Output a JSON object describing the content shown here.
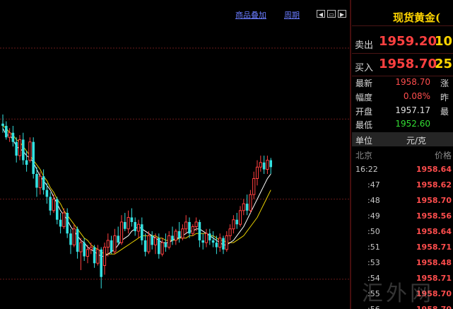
{
  "toolbar": {
    "overlay_label": "商品叠加",
    "period_label": "周期",
    "prev_label": "◀",
    "mid_label": "▭",
    "next_label": "▶"
  },
  "instrument": {
    "title": "现货黄金("
  },
  "quotes": {
    "sell": {
      "label": "卖出",
      "price": "1959.20",
      "volume": "10"
    },
    "buy": {
      "label": "买入",
      "price": "1958.70",
      "volume": "25"
    }
  },
  "stats": [
    {
      "label": "最新",
      "value": "1958.70",
      "color": "#ff4d4d",
      "label2": "涨"
    },
    {
      "label": "幅度",
      "value": "0.08%",
      "color": "#ff4d4d",
      "label2": "昨"
    },
    {
      "label": "开盘",
      "value": "1957.17",
      "color": "#e0e0e0",
      "label2": "最"
    },
    {
      "label": "最低",
      "value": "1952.60",
      "color": "#33dd33",
      "label2": ""
    }
  ],
  "unit": {
    "label": "单位",
    "value": "元/克"
  },
  "ticks_header": {
    "location": "北京",
    "price": "价格"
  },
  "ticks": [
    {
      "time": "16:22",
      "price": "1958.64"
    },
    {
      "time": ":47",
      "price": "1958.62"
    },
    {
      "time": ":48",
      "price": "1958.70"
    },
    {
      "time": ":49",
      "price": "1958.56"
    },
    {
      "time": ":50",
      "price": "1958.64"
    },
    {
      "time": ":51",
      "price": "1958.71"
    },
    {
      "time": ":53",
      "price": "1958.48"
    },
    {
      "time": ":54",
      "price": "1958.71"
    },
    {
      "time": ":55",
      "price": "1958.70"
    },
    {
      "time": ":56",
      "price": "1958.70"
    }
  ],
  "watermark": "汇外网",
  "colors": {
    "up": "#ff4040",
    "down": "#33e0e0",
    "ma1": "#ffffff",
    "ma2": "#e8d000",
    "grid": "#6a1a1a"
  },
  "chart_data": {
    "type": "candlestick",
    "ylim": [
      1949.5,
      1963.0
    ],
    "gridlines": [
      1960.9,
      1957.8,
      1954.3,
      1950.8
    ],
    "candles": [
      [
        1957.6,
        1958.0,
        1957.2,
        1957.5
      ],
      [
        1957.5,
        1957.7,
        1956.9,
        1957.0
      ],
      [
        1957.0,
        1957.4,
        1956.8,
        1957.2
      ],
      [
        1957.2,
        1957.5,
        1956.6,
        1956.8
      ],
      [
        1956.8,
        1957.0,
        1955.9,
        1956.2
      ],
      [
        1956.2,
        1957.1,
        1956.0,
        1956.9
      ],
      [
        1956.9,
        1957.2,
        1955.8,
        1956.0
      ],
      [
        1956.0,
        1956.4,
        1955.5,
        1955.8
      ],
      [
        1956.0,
        1957.0,
        1955.9,
        1956.8
      ],
      [
        1956.8,
        1957.0,
        1955.2,
        1955.4
      ],
      [
        1955.4,
        1955.7,
        1954.4,
        1954.8
      ],
      [
        1954.8,
        1955.5,
        1954.5,
        1955.3
      ],
      [
        1955.3,
        1955.6,
        1954.5,
        1954.7
      ],
      [
        1954.7,
        1955.0,
        1954.1,
        1954.4
      ],
      [
        1954.4,
        1954.6,
        1953.6,
        1953.8
      ],
      [
        1953.8,
        1954.5,
        1953.7,
        1954.3
      ],
      [
        1954.3,
        1954.4,
        1953.2,
        1953.4
      ],
      [
        1953.4,
        1953.7,
        1952.8,
        1953.1
      ],
      [
        1953.1,
        1953.9,
        1953.0,
        1953.7
      ],
      [
        1953.7,
        1953.9,
        1952.6,
        1952.8
      ],
      [
        1952.8,
        1953.0,
        1951.9,
        1952.3
      ],
      [
        1952.3,
        1953.2,
        1952.2,
        1953.0
      ],
      [
        1953.0,
        1953.1,
        1951.7,
        1952.0
      ],
      [
        1952.0,
        1952.6,
        1951.2,
        1952.4
      ],
      [
        1952.4,
        1952.6,
        1951.6,
        1951.8
      ],
      [
        1951.8,
        1952.3,
        1951.5,
        1952.1
      ],
      [
        1952.1,
        1952.4,
        1951.9,
        1952.2
      ],
      [
        1952.2,
        1952.3,
        1951.3,
        1951.5
      ],
      [
        1951.5,
        1952.3,
        1951.4,
        1952.1
      ],
      [
        1952.1,
        1952.2,
        1950.4,
        1950.9
      ],
      [
        1951.4,
        1952.4,
        1951.0,
        1952.2
      ],
      [
        1952.2,
        1952.8,
        1951.8,
        1952.5
      ],
      [
        1952.5,
        1952.7,
        1951.9,
        1952.0
      ],
      [
        1952.0,
        1953.0,
        1951.9,
        1952.7
      ],
      [
        1952.7,
        1953.1,
        1952.3,
        1952.4
      ],
      [
        1952.4,
        1953.6,
        1952.3,
        1953.3
      ],
      [
        1953.3,
        1953.7,
        1952.9,
        1953.0
      ],
      [
        1953.0,
        1953.8,
        1952.8,
        1953.5
      ],
      [
        1953.5,
        1953.9,
        1953.1,
        1953.3
      ],
      [
        1953.3,
        1953.5,
        1952.7,
        1952.9
      ],
      [
        1952.9,
        1953.4,
        1952.6,
        1953.2
      ],
      [
        1953.2,
        1953.5,
        1952.3,
        1952.5
      ],
      [
        1952.5,
        1952.8,
        1951.8,
        1952.0
      ],
      [
        1952.0,
        1952.9,
        1951.9,
        1952.7
      ],
      [
        1952.7,
        1952.9,
        1952.1,
        1952.3
      ],
      [
        1952.3,
        1952.8,
        1951.9,
        1952.6
      ],
      [
        1952.6,
        1952.8,
        1951.7,
        1951.9
      ],
      [
        1951.9,
        1952.6,
        1951.8,
        1952.4
      ],
      [
        1952.4,
        1952.8,
        1952.0,
        1952.2
      ],
      [
        1952.2,
        1952.9,
        1952.1,
        1952.7
      ],
      [
        1952.7,
        1953.1,
        1952.3,
        1952.5
      ],
      [
        1952.5,
        1953.0,
        1952.3,
        1952.9
      ],
      [
        1952.9,
        1953.3,
        1952.4,
        1952.6
      ],
      [
        1952.6,
        1953.2,
        1952.5,
        1953.0
      ],
      [
        1953.0,
        1953.6,
        1952.8,
        1953.3
      ],
      [
        1953.3,
        1953.5,
        1952.6,
        1952.8
      ],
      [
        1952.8,
        1953.2,
        1952.7,
        1953.1
      ],
      [
        1953.1,
        1953.5,
        1952.9,
        1953.3
      ],
      [
        1953.3,
        1953.4,
        1952.2,
        1952.5
      ],
      [
        1952.5,
        1952.8,
        1952.1,
        1952.4
      ],
      [
        1952.4,
        1953.0,
        1952.2,
        1952.8
      ],
      [
        1952.8,
        1953.0,
        1952.3,
        1952.5
      ],
      [
        1952.5,
        1952.9,
        1952.2,
        1952.4
      ],
      [
        1952.4,
        1952.7,
        1951.9,
        1952.2
      ],
      [
        1952.2,
        1952.8,
        1952.0,
        1952.6
      ],
      [
        1952.6,
        1952.7,
        1951.9,
        1952.1
      ],
      [
        1952.1,
        1952.9,
        1952.0,
        1952.7
      ],
      [
        1952.7,
        1953.2,
        1952.5,
        1953.0
      ],
      [
        1953.0,
        1953.6,
        1952.8,
        1953.4
      ],
      [
        1953.4,
        1953.7,
        1953.0,
        1953.2
      ],
      [
        1953.2,
        1954.0,
        1953.1,
        1953.8
      ],
      [
        1953.8,
        1954.3,
        1953.6,
        1954.1
      ],
      [
        1954.1,
        1954.5,
        1953.6,
        1953.8
      ],
      [
        1953.8,
        1954.7,
        1953.7,
        1954.5
      ],
      [
        1954.5,
        1955.5,
        1954.3,
        1955.2
      ],
      [
        1955.2,
        1956.0,
        1954.9,
        1955.7
      ],
      [
        1955.7,
        1956.2,
        1955.5,
        1955.9
      ],
      [
        1955.9,
        1956.2,
        1955.4,
        1955.6
      ],
      [
        1955.6,
        1956.2,
        1955.4,
        1956.0
      ],
      [
        1956.0,
        1956.1,
        1955.4,
        1955.7
      ]
    ],
    "ma_fast": [
      1957.4,
      1957.1,
      1957.1,
      1956.9,
      1956.6,
      1956.5,
      1956.4,
      1956.2,
      1956.1,
      1955.9,
      1955.6,
      1955.3,
      1955.1,
      1954.9,
      1954.7,
      1954.4,
      1954.1,
      1953.8,
      1953.6,
      1953.4,
      1953.1,
      1952.9,
      1952.7,
      1952.5,
      1952.4,
      1952.2,
      1952.1,
      1952.0,
      1951.9,
      1951.8,
      1951.8,
      1951.9,
      1952.0,
      1952.1,
      1952.3,
      1952.5,
      1952.6,
      1952.7,
      1952.9,
      1953.0,
      1953.1,
      1953.0,
      1952.9,
      1952.8,
      1952.7,
      1952.6,
      1952.5,
      1952.4,
      1952.4,
      1952.4,
      1952.5,
      1952.6,
      1952.6,
      1952.7,
      1952.8,
      1952.9,
      1952.9,
      1953.0,
      1953.0,
      1952.9,
      1952.8,
      1952.7,
      1952.6,
      1952.5,
      1952.4,
      1952.3,
      1952.3,
      1952.4,
      1952.5,
      1952.7,
      1952.9,
      1953.1,
      1953.4,
      1953.7,
      1954.0,
      1954.3,
      1954.6,
      1954.9,
      1955.2,
      1955.4
    ],
    "ma_slow": [
      1957.5,
      1957.4,
      1957.2,
      1957.1,
      1956.9,
      1956.8,
      1956.6,
      1956.4,
      1956.2,
      1956.0,
      1955.8,
      1955.6,
      1955.3,
      1955.1,
      1954.8,
      1954.6,
      1954.3,
      1954.1,
      1953.8,
      1953.6,
      1953.4,
      1953.2,
      1953.0,
      1952.8,
      1952.6,
      1952.5,
      1952.3,
      1952.2,
      1952.1,
      1952.0,
      1951.9,
      1951.9,
      1951.9,
      1951.9,
      1952.0,
      1952.1,
      1952.2,
      1952.3,
      1952.4,
      1952.5,
      1952.6,
      1952.7,
      1952.7,
      1952.7,
      1952.7,
      1952.7,
      1952.6,
      1952.6,
      1952.5,
      1952.5,
      1952.5,
      1952.5,
      1952.6,
      1952.6,
      1952.6,
      1952.7,
      1952.7,
      1952.8,
      1952.8,
      1952.8,
      1952.8,
      1952.7,
      1952.7,
      1952.6,
      1952.5,
      1952.5,
      1952.4,
      1952.4,
      1952.4,
      1952.5,
      1952.6,
      1952.7,
      1952.9,
      1953.1,
      1953.3,
      1953.5,
      1953.8,
      1954.1,
      1954.4,
      1954.7
    ]
  }
}
